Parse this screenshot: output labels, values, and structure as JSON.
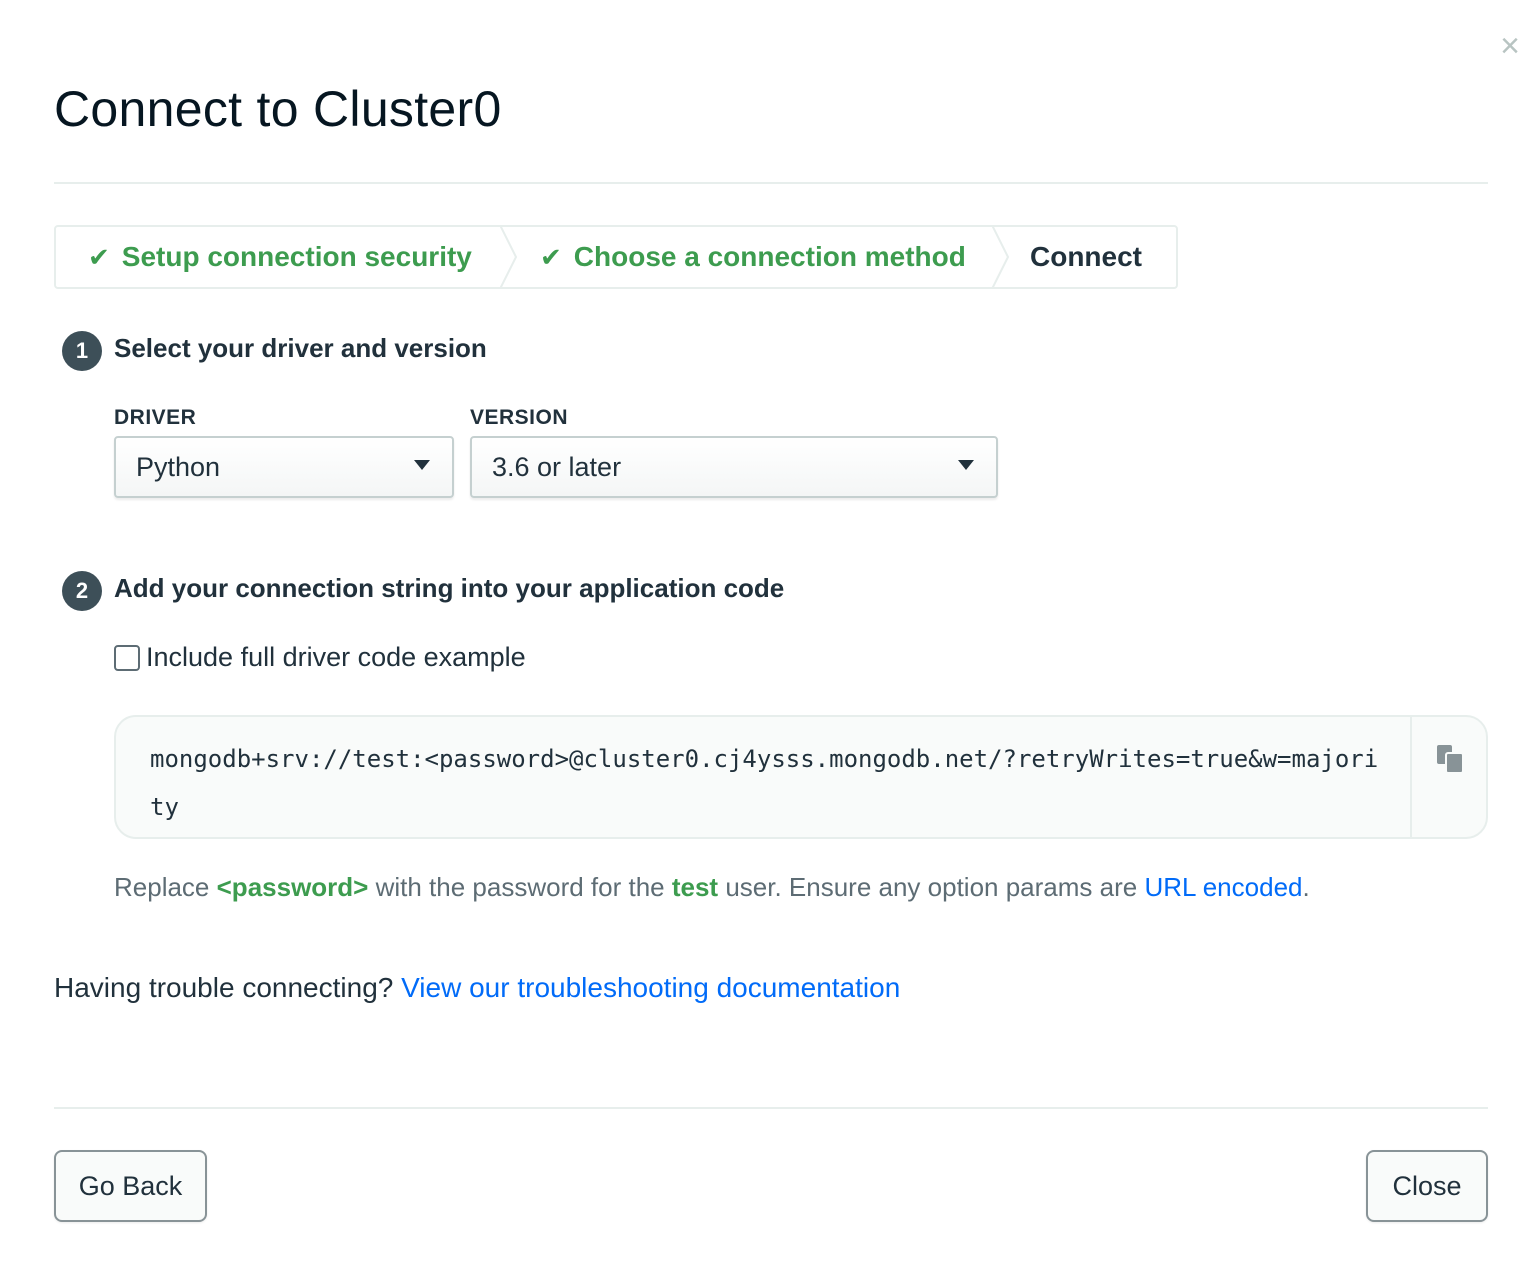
{
  "dialog": {
    "title": "Connect to Cluster0",
    "close_icon": "×"
  },
  "steps": [
    {
      "label": "Setup connection security",
      "status": "done"
    },
    {
      "label": "Choose a connection method",
      "status": "done"
    },
    {
      "label": "Connect",
      "status": "current"
    }
  ],
  "icons": {
    "check": "✔"
  },
  "section1": {
    "number": "1",
    "heading": "Select your driver and version",
    "driver_label": "DRIVER",
    "driver_value": "Python",
    "version_label": "VERSION",
    "version_value": "3.6 or later"
  },
  "section2": {
    "number": "2",
    "heading": "Add your connection string into your application code",
    "checkbox_label": "Include full driver code example",
    "checkbox_checked": false,
    "connection_string": "mongodb+srv://test:<password>@cluster0.cj4ysss.mongodb.net/?retryWrites=true&w=majority",
    "note": {
      "part1": "Replace ",
      "password_token": "<password>",
      "part2": " with the password for the ",
      "user_token": "test",
      "part3": " user. Ensure any option params are ",
      "link_text": "URL encoded",
      "part4": "."
    }
  },
  "trouble": {
    "text": "Having trouble connecting? ",
    "link_text": "View our troubleshooting documentation"
  },
  "footer": {
    "back_label": "Go Back",
    "close_label": "Close"
  },
  "colors": {
    "success_green": "#3d9c4f",
    "link_blue": "#016bf8",
    "badge_gray": "#3d4f58"
  }
}
